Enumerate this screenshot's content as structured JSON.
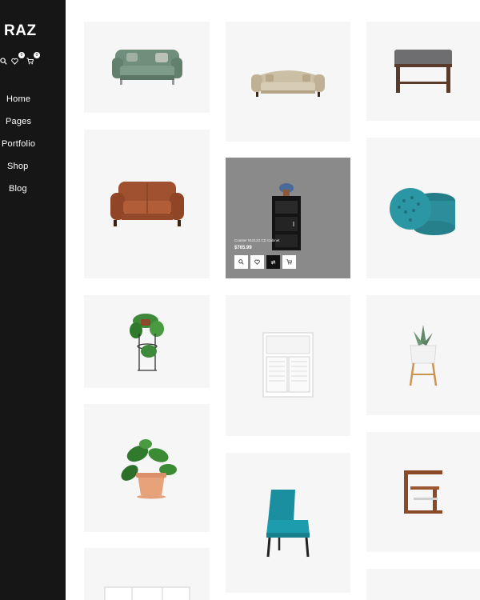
{
  "brand": {
    "logo": "RAZ"
  },
  "header_icons": {
    "wishlist_count": "0",
    "cart_count": "0"
  },
  "nav": {
    "items": [
      {
        "label": "Home"
      },
      {
        "label": "Pages"
      },
      {
        "label": "Portfolio"
      },
      {
        "label": "Shop"
      },
      {
        "label": "Blog"
      }
    ]
  },
  "products": {
    "hovered": {
      "name": "Coaster 910123 CD Cabinet",
      "price": "$765.99",
      "actions": [
        "quick-view",
        "wishlist",
        "compare",
        "add-to-cart"
      ]
    },
    "items": [
      {
        "icon": "green-loveseat-image"
      },
      {
        "icon": "beige-tufted-sofa-image"
      },
      {
        "icon": "gray-bench-image"
      },
      {
        "icon": "brown-leather-loveseat-image"
      },
      {
        "icon": "black-cabinet-image"
      },
      {
        "icon": "teal-tufted-ottoman-image"
      },
      {
        "icon": "hanging-plant-stand-image"
      },
      {
        "icon": "white-storage-cabinet-image"
      },
      {
        "icon": "potted-succulent-image"
      },
      {
        "icon": "potted-philodendron-image"
      },
      {
        "icon": "teal-accent-chair-image"
      },
      {
        "icon": "wooden-side-table-image"
      },
      {
        "icon": "white-tv-stand-image"
      }
    ]
  },
  "colors": {
    "sidebar_bg": "#161616",
    "card_bg": "#f6f6f6",
    "hover_overlay": "#8a8a8a"
  }
}
